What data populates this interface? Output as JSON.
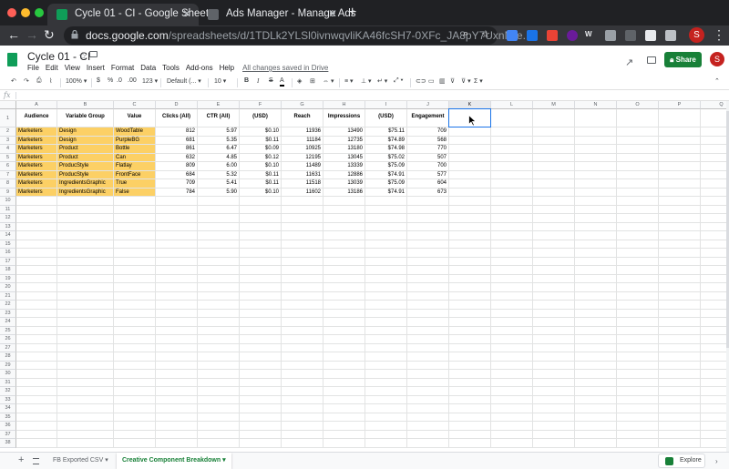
{
  "browser": {
    "tabs": [
      {
        "title": "Cycle 01 - CI - Google Sheets",
        "active": true
      },
      {
        "title": "Ads Manager - Manage Ads",
        "active": false
      }
    ],
    "url_host": "docs.google.com",
    "url_path": "/spreadsheets/d/1TDLk2YLSl0ivnwqvliKA46fcSH7-0XFc_JA8pY7UxnM/e...",
    "profile_initial": "S"
  },
  "sheet": {
    "doc_title": "Cycle 01 - CI",
    "menus": [
      "File",
      "Edit",
      "View",
      "Insert",
      "Format",
      "Data",
      "Tools",
      "Add-ons",
      "Help"
    ],
    "saved_status": "All changes saved in Drive",
    "share_label": "Share",
    "avatar_initial": "S"
  },
  "toolbar": {
    "zoom": "100%",
    "currency": "$",
    "percent": "%",
    "decimal_less": ".0",
    "decimal_more": ".00",
    "number_format": "123",
    "font": "Default (...",
    "font_size": "10",
    "bold": "B",
    "italic": "I",
    "strike": "S",
    "text_color": "A"
  },
  "formula_bar": {
    "fx_label": "fx",
    "content": ""
  },
  "grid": {
    "columns": [
      "A",
      "B",
      "C",
      "D",
      "E",
      "F",
      "G",
      "H",
      "I",
      "J",
      "K",
      "L",
      "M",
      "N",
      "O",
      "P",
      "Q"
    ],
    "row_count": 38,
    "headers": [
      "Audience",
      "Variable Group",
      "Value",
      "Clicks (All)",
      "CTR (All)",
      "CPC (All) (USD)",
      "Reach",
      "Impressions",
      "Amount Spent (USD)",
      "Post Engagement"
    ],
    "rows": [
      [
        "Marketers",
        "Design",
        "WoodTable",
        "812",
        "5.97",
        "$0.10",
        "11936",
        "13490",
        "$75.11",
        "709"
      ],
      [
        "Marketers",
        "Design",
        "PurpleBG",
        "681",
        "5.35",
        "$0.11",
        "11184",
        "12735",
        "$74.89",
        "568"
      ],
      [
        "Marketers",
        "Product",
        "Bottle",
        "861",
        "6.47",
        "$0.09",
        "10925",
        "13180",
        "$74.98",
        "770"
      ],
      [
        "Marketers",
        "Product",
        "Can",
        "632",
        "4.85",
        "$0.12",
        "12195",
        "13045",
        "$75.02",
        "507"
      ],
      [
        "Marketers",
        "ProducStyle",
        "Flatlay",
        "809",
        "6.00",
        "$0.10",
        "11489",
        "13339",
        "$75.09",
        "700"
      ],
      [
        "Marketers",
        "ProducStyle",
        "FrontFace",
        "684",
        "5.32",
        "$0.11",
        "11631",
        "12886",
        "$74.91",
        "577"
      ],
      [
        "Marketers",
        "IngredientsGraphic",
        "True",
        "709",
        "5.41",
        "$0.11",
        "11518",
        "13039",
        "$75.09",
        "604"
      ],
      [
        "Marketers",
        "IngredientsGraphic",
        "False",
        "784",
        "5.90",
        "$0.10",
        "11602",
        "13186",
        "$74.91",
        "673"
      ]
    ],
    "selected_cell": "K1"
  },
  "sheet_tabs": [
    {
      "name": "FB Exported CSV",
      "active": false
    },
    {
      "name": "Creative Component Breakdown",
      "active": true
    }
  ],
  "explore_label": "Explore",
  "colors": {
    "highlight": "#fcd065",
    "selection": "#1a73e8",
    "share": "#188038"
  }
}
